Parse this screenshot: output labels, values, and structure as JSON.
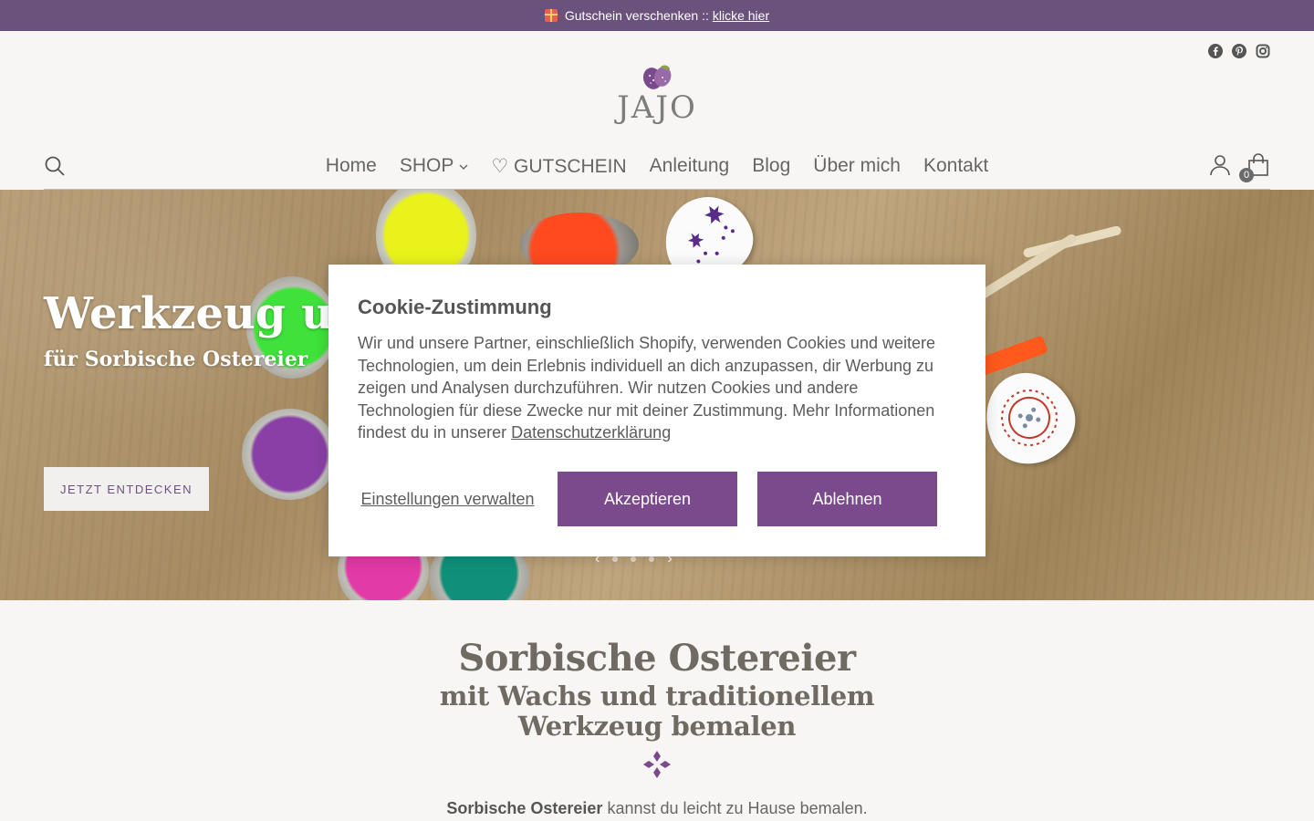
{
  "announcement": {
    "text": "Gutschein verschenken ::",
    "link": "klicke hier"
  },
  "brand": {
    "name": "JAJO",
    "accent": "#6b527c",
    "button_purple": "#7a4a8c"
  },
  "socials": [
    "facebook-icon",
    "pinterest-icon",
    "instagram-icon"
  ],
  "nav": {
    "items": [
      {
        "label": "Home"
      },
      {
        "label": "SHOP",
        "has_dropdown": true
      },
      {
        "label": "♡ GUTSCHEIN"
      },
      {
        "label": "Anleitung"
      },
      {
        "label": "Blog"
      },
      {
        "label": "Über mich"
      },
      {
        "label": "Kontakt"
      }
    ],
    "cart_count": "0"
  },
  "hero": {
    "title": "Werkzeug und",
    "subtitle": "für Sorbische Ostereier",
    "button": "JETZT ENTDECKEN"
  },
  "intro": {
    "heading": "Sorbische Ostereier",
    "subheading": "mit Wachs und traditionellem Werkzeug bemalen",
    "text_bold": "Sorbische Ostereier",
    "text_rest": " kannst du leicht zu Hause bemalen."
  },
  "cookie": {
    "title": "Cookie-Zustimmung",
    "body": "Wir und unsere Partner, einschließlich Shopify, verwenden Cookies und weitere Technologien, um dein Erlebnis individuell an dich anzupassen, dir Werbung zu zeigen und Analysen durchzuführen. Wir nutzen Cookies und andere Technologien für diese Zwecke nur mit deiner Zustimmung. Mehr Informationen findest du in unserer ",
    "privacy_link": "Datenschutzerklärung",
    "manage": "Einstellungen verwalten",
    "accept": "Akzeptieren",
    "reject": "Ablehnen"
  }
}
